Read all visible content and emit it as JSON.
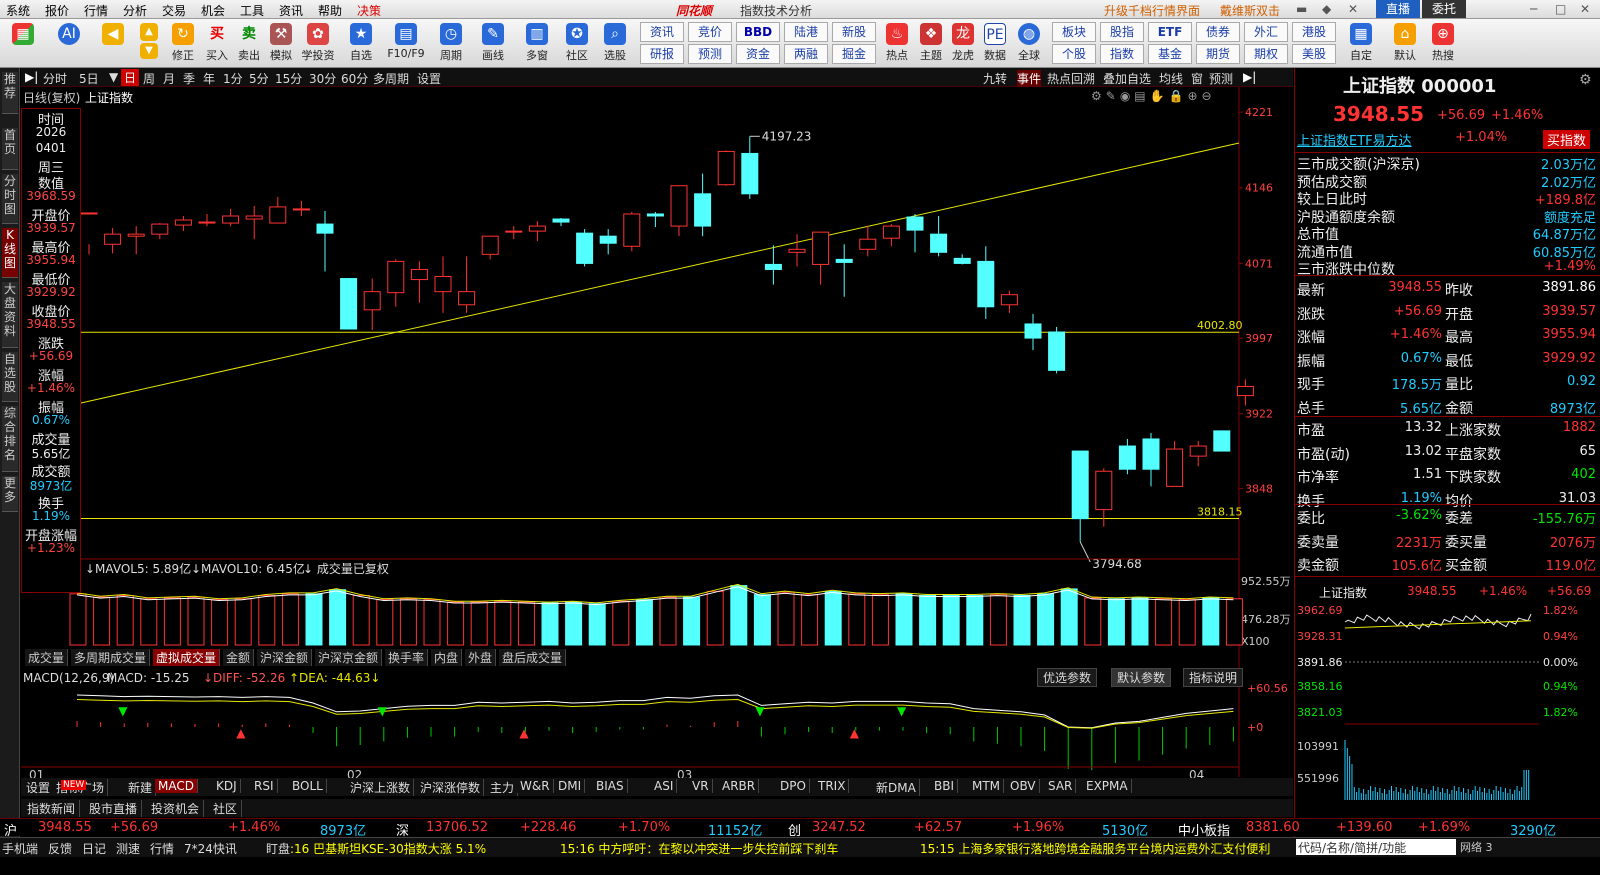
{
  "menu": {
    "items": [
      "系统",
      "报价",
      "行情",
      "分析",
      "交易",
      "机会",
      "工具",
      "资讯",
      "帮助",
      "决策"
    ],
    "brand": "同花顺",
    "title": "指数技术分析",
    "upgrade": "升级千档行情界面",
    "promo": "戴维斯双击",
    "live": "直播",
    "trust": "委托"
  },
  "toolbar": {
    "buttons": [
      "修正",
      "买入",
      "卖出",
      "模拟",
      "学投资",
      "自选",
      "F10/F9",
      "周期",
      "画线",
      "多窗",
      "社区",
      "选股"
    ],
    "grid": [
      [
        "资讯",
        "竞价",
        "BBD",
        "陆港",
        "新股"
      ],
      [
        "研报",
        "预测",
        "资金",
        "两融",
        "掘金"
      ]
    ],
    "right": [
      "热点",
      "主题",
      "龙虎",
      "数据",
      "全球"
    ],
    "grid2": [
      [
        "板块",
        "股指",
        "ETF",
        "债券",
        "外汇",
        "港股"
      ],
      [
        "个股",
        "指数",
        "基金",
        "期货",
        "期权",
        "美股"
      ]
    ],
    "right2": [
      "自定",
      "默认",
      "热搜"
    ]
  },
  "sidebar": [
    "推荐",
    "首页",
    "分时图",
    "K线图",
    "大盘资料",
    "自选股",
    "综合排名",
    "更多"
  ],
  "period": {
    "items": [
      "分时",
      "5日",
      "日",
      "周",
      "月",
      "季",
      "年",
      "1分",
      "5分",
      "15分",
      "30分",
      "60分",
      "多周期",
      "设置"
    ],
    "right": [
      "九转",
      "事件",
      "热点回溯",
      "叠加自选",
      "均线",
      "窗",
      "预测"
    ]
  },
  "chart": {
    "label": "日线(复权)",
    "name": "上证指数",
    "ylabels": [
      "4221",
      "4146",
      "4071",
      "3997",
      "3922",
      "3848"
    ],
    "hi_label": "4197.23",
    "lo_label": "3794.68",
    "line1": "4002.80",
    "line2": "3818.15",
    "xlabels": [
      "01",
      "02",
      "03",
      "04"
    ]
  },
  "info": [
    {
      "k": "时间",
      "v": "2026"
    },
    {
      "k": "",
      "v": "0401"
    },
    {
      "k": "周三",
      "v": ""
    },
    {
      "k": "数值",
      "v": "3968.59"
    },
    {
      "k": "开盘价",
      "v": "3939.57"
    },
    {
      "k": "最高价",
      "v": "3955.94"
    },
    {
      "k": "最低价",
      "v": "3929.92"
    },
    {
      "k": "收盘价",
      "v": "3948.55"
    },
    {
      "k": "涨跌",
      "v": "+56.69"
    },
    {
      "k": "涨幅",
      "v": "+1.46%"
    },
    {
      "k": "振幅",
      "v": "0.67%"
    },
    {
      "k": "成交量",
      "v": "5.65亿"
    },
    {
      "k": "成交额",
      "v": "8973亿"
    },
    {
      "k": "换手",
      "v": "1.19%"
    },
    {
      "k": "开盘涨幅",
      "v": "+1.23%"
    }
  ],
  "volume": {
    "label_mavol5": "MAVOL5: 5.89亿",
    "label_mavol10": "MAVOL10: 6.45亿",
    "note": "成交量已复权",
    "y1": "952.55万",
    "y2": "476.28万",
    "unit": "X100"
  },
  "vol_tabs": [
    "成交量",
    "多周期成交量",
    "虚拟成交量",
    "金额",
    "沪深金额",
    "沪深京金额",
    "换手率",
    "内盘",
    "外盘",
    "盘后成交量"
  ],
  "macd": {
    "label": "MACD(12,26,9)",
    "macd": "MACD: -15.25",
    "diff": "DIFF: -52.26",
    "dea": "DEA: -44.63",
    "y1": "+60.56",
    "y0": "+0",
    "btn1": "优选参数",
    "btn2": "默认参数",
    "btn3": "指标说明"
  },
  "ind_tabs": [
    "设置",
    "指标广场",
    "新建",
    "MACD",
    "KDJ",
    "RSI",
    "BOLL",
    "沪深上涨数",
    "沪深涨停数",
    "主力",
    "W&R",
    "DMI",
    "BIAS",
    "ASI",
    "VR",
    "ARBR",
    "DPO",
    "TRIX",
    "新DMA",
    "BBI",
    "MTM",
    "OBV",
    "SAR",
    "EXPMA"
  ],
  "bottom_tabs": [
    "指数新闻",
    "股市直播",
    "投资机会",
    "社区"
  ],
  "quote": {
    "title": "上证指数 000001",
    "price": "3948.55",
    "chg": "+56.69",
    "pct": "+1.46%",
    "etf": "上证指数ETF易方达",
    "etf_pct": "+1.04%",
    "buy": "买指数",
    "rows1": [
      [
        "三市成交额(沪深京)",
        "2.03万亿"
      ],
      [
        "预估成交额",
        "2.02万亿"
      ],
      [
        "较上日此时",
        "+189.8亿"
      ],
      [
        "沪股通额度余额",
        "额度充足"
      ],
      [
        "总市值",
        "64.87万亿"
      ],
      [
        "流通市值",
        "60.85万亿"
      ],
      [
        "三市涨跌中位数",
        "+1.49%"
      ]
    ],
    "rows2": [
      [
        "最新",
        "3948.55",
        "昨收",
        "3891.86"
      ],
      [
        "涨跌",
        "+56.69",
        "开盘",
        "3939.57"
      ],
      [
        "涨幅",
        "+1.46%",
        "最高",
        "3955.94"
      ],
      [
        "振幅",
        "0.67%",
        "最低",
        "3929.92"
      ],
      [
        "现手",
        "178.5万",
        "量比",
        "0.92"
      ],
      [
        "总手",
        "5.65亿",
        "金额",
        "8973亿"
      ]
    ],
    "rows3": [
      [
        "市盈",
        "13.32",
        "上涨家数",
        "1882"
      ],
      [
        "市盈(动)",
        "13.02",
        "平盘家数",
        "65"
      ],
      [
        "市净率",
        "1.51",
        "下跌家数",
        "402"
      ],
      [
        "换手",
        "1.19%",
        "均价",
        "31.03"
      ]
    ],
    "rows4": [
      [
        "委比",
        "-3.62%",
        "委差",
        "-155.76万"
      ],
      [
        "委卖量",
        "2231万",
        "委买量",
        "2076万"
      ],
      [
        "卖金额",
        "105.6亿",
        "买金额",
        "119.0亿"
      ]
    ],
    "mini": {
      "name": "上证指数",
      "price": "3948.55",
      "pct": "+1.46%",
      "chg": "+56.69",
      "y": [
        "3962.69",
        "3928.31",
        "3891.86",
        "3858.16",
        "3821.03",
        "103991",
        "551996"
      ],
      "yr": [
        "1.82%",
        "0.94%",
        "0.00%",
        "0.94%",
        "1.82%"
      ]
    }
  },
  "ticker": [
    [
      "沪",
      "3948.55",
      "+56.69",
      "+1.46%",
      "8973亿"
    ],
    [
      "深",
      "13706.52",
      "+228.46",
      "+1.70%",
      "11152亿"
    ],
    [
      "创",
      "3247.52",
      "+62.57",
      "+1.96%",
      "5130亿"
    ],
    [
      "中小板指",
      "8381.60",
      "+139.60",
      "+1.69%",
      "3290亿"
    ]
  ],
  "status": {
    "left": [
      "手机端",
      "反馈",
      "日记",
      "测速",
      "行情",
      "7*24快讯",
      "盯盘"
    ],
    "news1": ":16 巴基斯坦KSE-30指数大涨 5.1%",
    "news2": "15:16 中方呼吁：在黎以冲突进一步失控前踩下刹车",
    "news3": "15:15 上海多家银行落地跨境金融服务平台境内运费外汇支付便利",
    "right": "代码/名称/简拼/功能",
    "net": "网络 3"
  },
  "candles": [
    [
      4120,
      4121,
      4090,
      4080
    ],
    [
      4090,
      4100,
      4106,
      4081
    ],
    [
      4098,
      4100,
      4108,
      4080
    ],
    [
      4100,
      4110,
      4111,
      4095
    ],
    [
      4109,
      4114,
      4118,
      4103
    ],
    [
      4112,
      4112,
      4120,
      4108
    ],
    [
      4111,
      4118,
      4125,
      4108
    ],
    [
      4115,
      4118,
      4128,
      4095
    ],
    [
      4111,
      4127,
      4137,
      4111
    ],
    [
      4125,
      4125,
      4133,
      4118
    ],
    [
      4110,
      4101,
      4123,
      4063
    ],
    [
      4056,
      4006,
      4056,
      4006
    ],
    [
      4025,
      4043,
      4056,
      4005
    ],
    [
      4042,
      4073,
      4075,
      4028
    ],
    [
      4055,
      4065,
      4073,
      4032
    ],
    [
      4043,
      4058,
      4078,
      4022
    ],
    [
      4030,
      4043,
      4078,
      4022
    ],
    [
      4080,
      4098,
      4098,
      4075
    ],
    [
      4103,
      4103,
      4108,
      4095
    ],
    [
      4103,
      4108,
      4113,
      4093
    ],
    [
      4115,
      4112,
      4116,
      4108
    ],
    [
      4101,
      4071,
      4105,
      4068
    ],
    [
      4098,
      4091,
      4105,
      4080
    ],
    [
      4088,
      4120,
      4122,
      4083
    ],
    [
      4120,
      4118,
      4122,
      4107
    ],
    [
      4108,
      4148,
      4148,
      4098
    ],
    [
      4140,
      4108,
      4160,
      4098
    ],
    [
      4149,
      4182,
      4183,
      4148
    ],
    [
      4180,
      4140,
      4197,
      4135
    ],
    [
      4070,
      4065,
      4089,
      4050
    ],
    [
      4082,
      4085,
      4100,
      4068
    ],
    [
      4070,
      4102,
      4102,
      4050
    ],
    [
      4075,
      4072,
      4090,
      4038
    ],
    [
      4085,
      4095,
      4108,
      4078
    ],
    [
      4096,
      4108,
      4110,
      4088
    ],
    [
      4117,
      4104,
      4120,
      4082
    ],
    [
      4100,
      4082,
      4118,
      4078
    ],
    [
      4076,
      4071,
      4080,
      4070
    ],
    [
      4073,
      4028,
      4088,
      4016
    ],
    [
      4030,
      4040,
      4044,
      4022
    ],
    [
      4011,
      3997,
      4021,
      3985
    ],
    [
      4003,
      3965,
      4008,
      3962
    ],
    [
      3885,
      3818,
      3885,
      3795
    ],
    [
      3827,
      3865,
      3868,
      3810
    ],
    [
      3890,
      3867,
      3897,
      3862
    ],
    [
      3897,
      3867,
      3903,
      3850
    ],
    [
      3850,
      3887,
      3895,
      3850
    ],
    [
      3880,
      3890,
      3895,
      3870
    ],
    [
      3905,
      3885,
      3905,
      3885
    ],
    [
      3940,
      3949,
      3956,
      3930
    ]
  ],
  "vols": [
    0.62,
    0.58,
    0.6,
    0.56,
    0.57,
    0.58,
    0.55,
    0.56,
    0.6,
    0.62,
    0.62,
    0.67,
    0.6,
    0.55,
    0.56,
    0.55,
    0.52,
    0.52,
    0.53,
    0.52,
    0.51,
    0.52,
    0.5,
    0.53,
    0.55,
    0.58,
    0.58,
    0.65,
    0.72,
    0.61,
    0.64,
    0.61,
    0.65,
    0.62,
    0.61,
    0.62,
    0.6,
    0.6,
    0.6,
    0.61,
    0.6,
    0.62,
    0.68,
    0.57,
    0.56,
    0.57,
    0.56,
    0.55,
    0.57,
    0.56
  ],
  "macd_vals": [
    0.5,
    0.4,
    0.3,
    0.35,
    0.3,
    0.25,
    0.3,
    0.2,
    0.3,
    0.2,
    -0.5,
    -1.6,
    -1.5,
    -1.2,
    -0.9,
    -0.8,
    -0.8,
    -0.4,
    -0.5,
    -0.4,
    -0.3,
    -0.5,
    -0.4,
    -0.2,
    -0.2,
    0.2,
    0.1,
    0.4,
    0.5,
    -0.8,
    -0.6,
    -0.4,
    -0.5,
    -0.3,
    -0.3,
    -0.3,
    -0.5,
    -0.6,
    -1.2,
    -1.4,
    -1.6,
    -2.0,
    -3.5,
    -3.6,
    -3.0,
    -2.8,
    -2.3,
    -1.8,
    -1.5,
    -1.2
  ]
}
